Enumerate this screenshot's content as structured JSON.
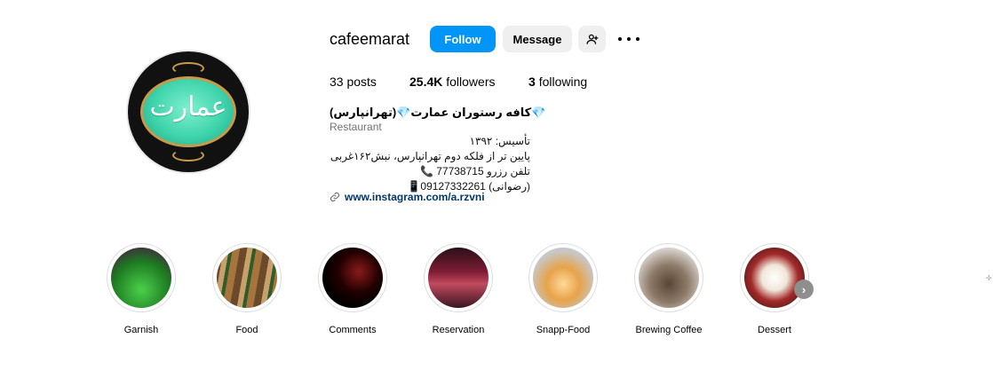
{
  "profile": {
    "username": "cafeemarat",
    "avatar_text": "عمارت",
    "follow_label": "Follow",
    "message_label": "Message",
    "add_user_icon": "add-user-icon",
    "more_icon": "more-options-icon"
  },
  "stats": {
    "posts_count": "33",
    "posts_label": "posts",
    "followers_count": "25.4K",
    "followers_label": "followers",
    "following_count": "3",
    "following_label": "following"
  },
  "bio": {
    "name": "💎کافه رستوران عمارت💎(تهرانپارس)",
    "category": "Restaurant",
    "lines": [
      "تأسیس: ۱۳۹۲",
      "پایین تر از فلکه دوم تهرانپارس، نبش۱۶۲غربی",
      "تلفن رزرو 77738715 📞",
      "(رضوانی) 09127332261📱"
    ],
    "link": "www.instagram.com/a.rzvni"
  },
  "highlights": [
    {
      "label": "Garnish"
    },
    {
      "label": "Food"
    },
    {
      "label": "Comments"
    },
    {
      "label": "Reservation"
    },
    {
      "label": "Snapp-Food"
    },
    {
      "label": "Brewing Coffee"
    },
    {
      "label": "Dessert"
    }
  ],
  "colors": {
    "follow_button": "#0095f6",
    "secondary_button": "#efefef",
    "link": "#00376b",
    "muted": "#737373"
  }
}
